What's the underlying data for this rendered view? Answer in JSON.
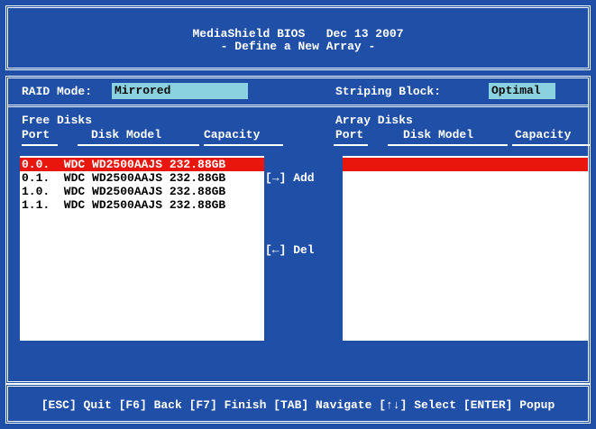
{
  "header": {
    "title": "MediaShield BIOS   Dec 13 2007",
    "subtitle": "- Define a New Array -"
  },
  "config": {
    "raid_mode_label": "RAID Mode:",
    "raid_mode_value": "Mirrored",
    "striping_block_label": "Striping Block:",
    "striping_block_value": "Optimal"
  },
  "free_disks": {
    "heading": "Free Disks",
    "columns": [
      "Port",
      "Disk Model",
      "Capacity"
    ],
    "rows": [
      {
        "text": "0.0.  WDC WD2500AAJS 232.88GB",
        "selected": true
      },
      {
        "text": "0.1.  WDC WD2500AAJS 232.88GB",
        "selected": false
      },
      {
        "text": "1.0.  WDC WD2500AAJS 232.88GB",
        "selected": false
      },
      {
        "text": "1.1.  WDC WD2500AAJS 232.88GB",
        "selected": false
      }
    ]
  },
  "array_disks": {
    "heading": "Array Disks",
    "columns": [
      "Port",
      "Disk Model",
      "Capacity"
    ]
  },
  "actions": {
    "add_label": "[→] Add",
    "del_label": "[←] Del"
  },
  "footer": {
    "help": "[ESC] Quit [F6] Back [F7] Finish [TAB] Navigate [↑↓] Select [ENTER] Popup"
  },
  "colors": {
    "background": "#1f4fa6",
    "field": "#8ad2e0",
    "selection": "#e8160c"
  }
}
